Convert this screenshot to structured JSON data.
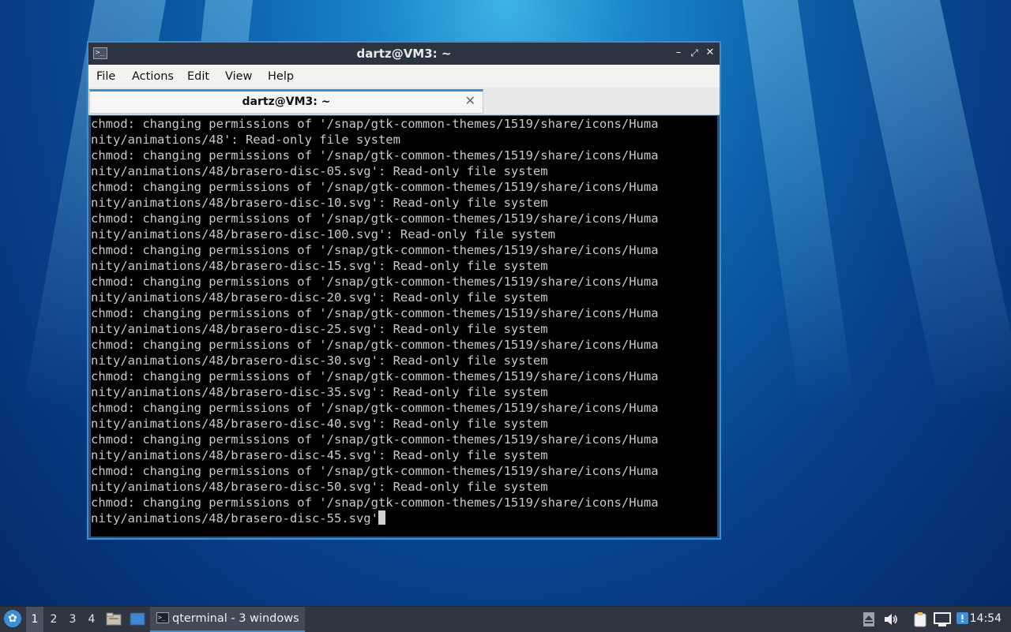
{
  "window": {
    "title": "dartz@VM3: ~",
    "icon": "terminal-icon",
    "controls": [
      "minimize-icon",
      "maximize-icon",
      "close-icon"
    ]
  },
  "menubar": {
    "items": [
      "File",
      "Actions",
      "Edit",
      "View",
      "Help"
    ]
  },
  "tab": {
    "label": "dartz@VM3: ~",
    "close_glyph": "✕"
  },
  "terminal": {
    "lines": [
      "chmod: changing permissions of '/snap/gtk-common-themes/1519/share/icons/Huma",
      "nity/animations/48': Read-only file system",
      "chmod: changing permissions of '/snap/gtk-common-themes/1519/share/icons/Huma",
      "nity/animations/48/brasero-disc-05.svg': Read-only file system",
      "chmod: changing permissions of '/snap/gtk-common-themes/1519/share/icons/Huma",
      "nity/animations/48/brasero-disc-10.svg': Read-only file system",
      "chmod: changing permissions of '/snap/gtk-common-themes/1519/share/icons/Huma",
      "nity/animations/48/brasero-disc-100.svg': Read-only file system",
      "chmod: changing permissions of '/snap/gtk-common-themes/1519/share/icons/Huma",
      "nity/animations/48/brasero-disc-15.svg': Read-only file system",
      "chmod: changing permissions of '/snap/gtk-common-themes/1519/share/icons/Huma",
      "nity/animations/48/brasero-disc-20.svg': Read-only file system",
      "chmod: changing permissions of '/snap/gtk-common-themes/1519/share/icons/Huma",
      "nity/animations/48/brasero-disc-25.svg': Read-only file system",
      "chmod: changing permissions of '/snap/gtk-common-themes/1519/share/icons/Huma",
      "nity/animations/48/brasero-disc-30.svg': Read-only file system",
      "chmod: changing permissions of '/snap/gtk-common-themes/1519/share/icons/Huma",
      "nity/animations/48/brasero-disc-35.svg': Read-only file system",
      "chmod: changing permissions of '/snap/gtk-common-themes/1519/share/icons/Huma",
      "nity/animations/48/brasero-disc-40.svg': Read-only file system",
      "chmod: changing permissions of '/snap/gtk-common-themes/1519/share/icons/Huma",
      "nity/animations/48/brasero-disc-45.svg': Read-only file system",
      "chmod: changing permissions of '/snap/gtk-common-themes/1519/share/icons/Huma",
      "nity/animations/48/brasero-disc-50.svg': Read-only file system",
      "chmod: changing permissions of '/snap/gtk-common-themes/1519/share/icons/Huma",
      "nity/animations/48/brasero-disc-55.svg'"
    ]
  },
  "taskbar": {
    "start_icon": "lubuntu-logo-icon",
    "workspaces": [
      "1",
      "2",
      "3",
      "4"
    ],
    "active_workspace": "1",
    "quicklaunch": [
      "file-manager-icon",
      "show-desktop-icon"
    ],
    "task": {
      "label": "qterminal - 3 windows",
      "icon": "terminal-icon"
    },
    "tray": [
      "eject-icon",
      "volume-icon",
      "clipboard-icon",
      "network-icon",
      "update-notifier-icon"
    ],
    "clock": "14:54"
  },
  "colors": {
    "accent": "#3b8fd6",
    "titlebar": "#2b3440",
    "terminal_bg": "#000000",
    "terminal_fg": "#c9c9c9",
    "taskbar": "#2f3541"
  }
}
